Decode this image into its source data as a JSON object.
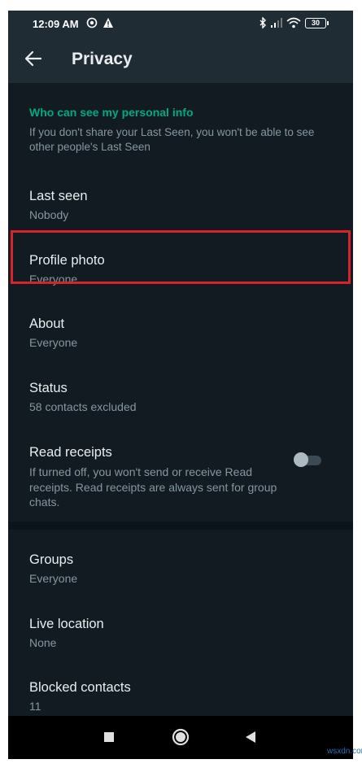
{
  "status_bar": {
    "time": "12:09 AM",
    "battery": "30",
    "icons": [
      "target-icon",
      "alert-icon",
      "bluetooth-icon",
      "signal-icon",
      "wifi-icon",
      "battery-icon"
    ]
  },
  "app_bar": {
    "title": "Privacy",
    "back_icon": "arrow-left-icon"
  },
  "section": {
    "title": "Who can see my personal info",
    "description": "If you don't share your Last Seen, you won't be able to see other people's Last Seen"
  },
  "settings": [
    {
      "label": "Last seen",
      "value": "Nobody"
    },
    {
      "label": "Profile photo",
      "value": "Everyone"
    },
    {
      "label": "About",
      "value": "Everyone"
    },
    {
      "label": "Status",
      "value": "58 contacts excluded"
    },
    {
      "label": "Read receipts",
      "description": "If turned off, you won't send or receive Read receipts. Read receipts are always sent for group chats.",
      "toggle_on": false
    },
    {
      "label": "Groups",
      "value": "Everyone"
    },
    {
      "label": "Live location",
      "value": "None"
    },
    {
      "label": "Blocked contacts",
      "value": "11"
    }
  ],
  "nav_bar": {
    "icons": [
      "recents-square-icon",
      "home-circle-icon",
      "back-triangle-icon"
    ]
  },
  "watermark": "wsxdn.com",
  "colors": {
    "background": "#121b22",
    "header": "#1f2c34",
    "accent": "#00a884",
    "highlight_border": "#d8232a"
  }
}
